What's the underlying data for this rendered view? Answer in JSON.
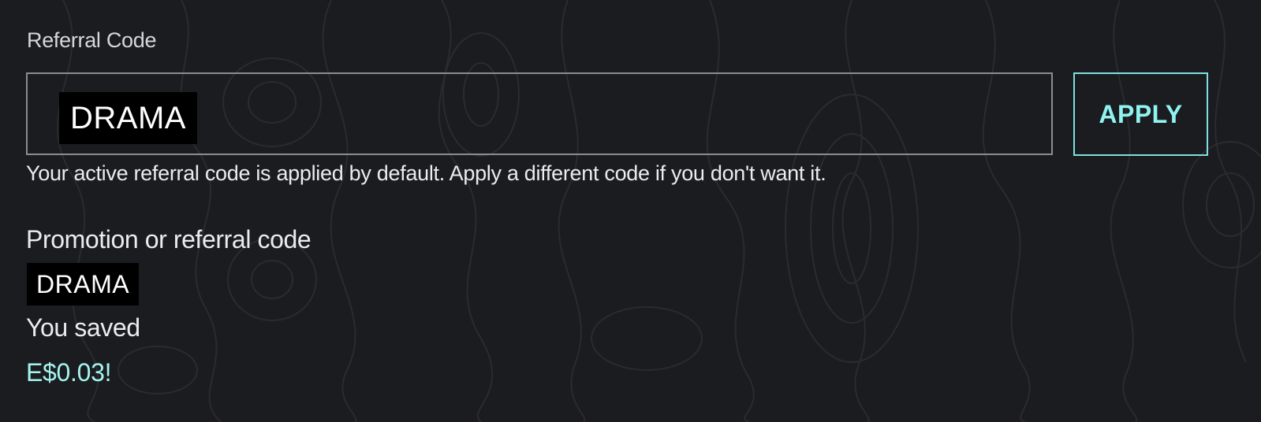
{
  "referral": {
    "label": "Referral Code",
    "value": "DRAMA",
    "apply_label": "APPLY",
    "helper_text": "Your active referral code is applied by default. Apply a different code if you don't want it."
  },
  "promotion": {
    "label": "Promotion or referral code",
    "code": "DRAMA",
    "saved_label": "You saved",
    "saved_amount": "E$0.03!"
  },
  "colors": {
    "background": "#1b1c20",
    "accent": "#8ff3ef",
    "text": "#ececed",
    "border": "#8a8c90"
  }
}
